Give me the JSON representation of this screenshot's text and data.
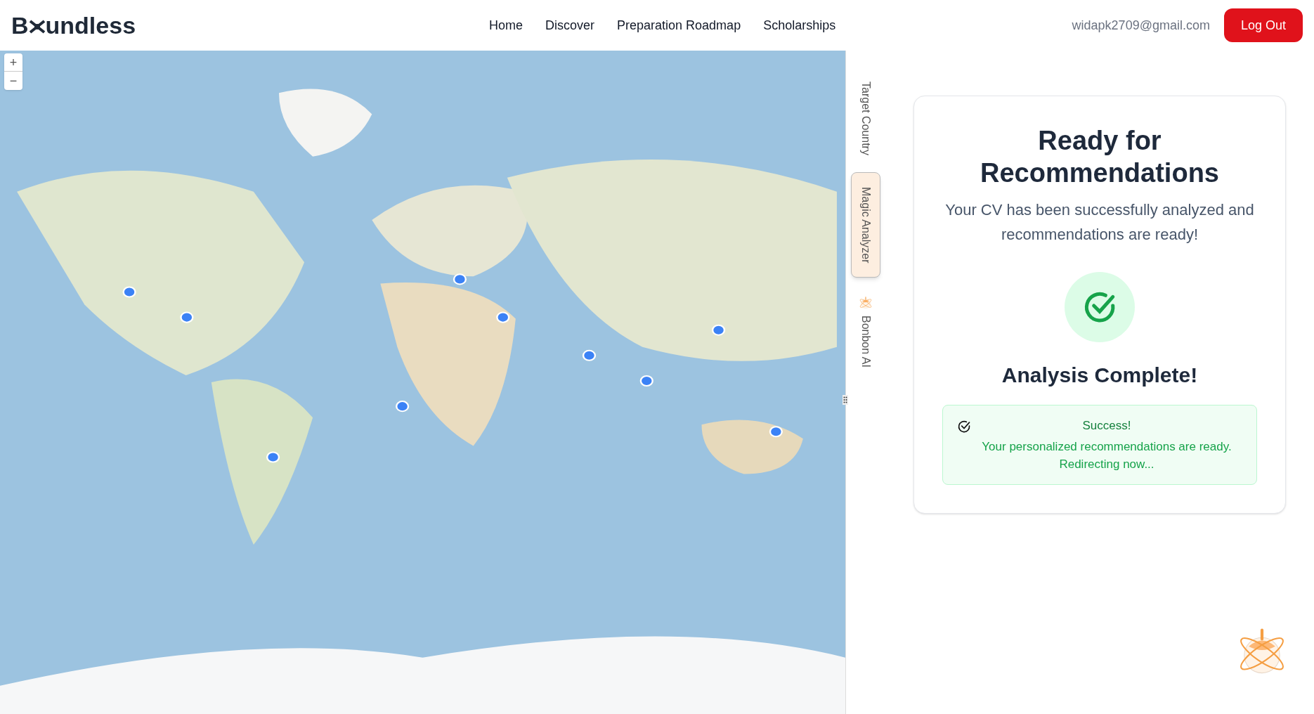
{
  "header": {
    "logo": {
      "before": "B",
      "after": "undless"
    },
    "nav": [
      {
        "label": "Home"
      },
      {
        "label": "Discover"
      },
      {
        "label": "Preparation Roadmap"
      },
      {
        "label": "Scholarships"
      }
    ],
    "email": "widapk2709@gmail.com",
    "logout": "Log Out"
  },
  "map": {
    "zoom_in": "+",
    "zoom_out": "−"
  },
  "side_tabs": [
    {
      "label": "Target Country",
      "selected": false,
      "kind": "text"
    },
    {
      "label": "Magic Analyzer",
      "selected": true,
      "kind": "text"
    },
    {
      "label": "Bonbon AI",
      "selected": false,
      "kind": "mascot"
    }
  ],
  "card": {
    "title": "Ready for Recommendations",
    "subtitle": "Your CV has been successfully analyzed and recommendations are ready!",
    "status": "Analysis Complete!",
    "alert": {
      "title": "Success!",
      "message": "Your personalized recommendations are ready. Redirecting now..."
    }
  }
}
